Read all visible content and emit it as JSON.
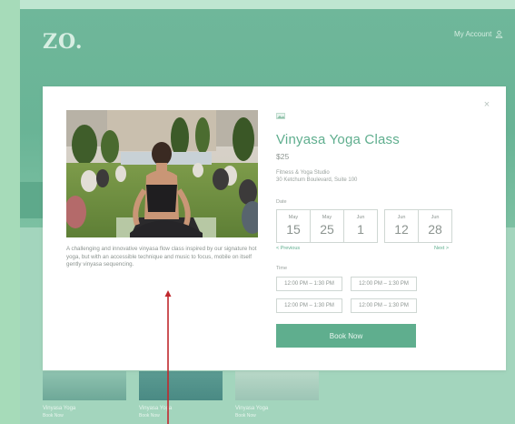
{
  "site": {
    "logo": "ZO.",
    "account_label": "My Account",
    "thumbnails": [
      {
        "title": "Vinyasa Yoga",
        "subtitle": "Book Now"
      },
      {
        "title": "Vinyasa Yoga",
        "subtitle": "Book Now"
      },
      {
        "title": "Vinyasa Yoga",
        "subtitle": "Book Now"
      }
    ]
  },
  "modal": {
    "close_glyph": "×",
    "description": "A challenging and innovative vinyasa flow class inspired by our signature hot yoga, but with an accessible technique and music to focus, mobile on itself gently vinyasa sequencing.",
    "title": "Vinyasa Yoga Class",
    "price": "$25",
    "address_line1": "Fitness & Yoga Studio",
    "address_line2": "30 Ketchum Boulevard, Suite 100",
    "date_label": "Date",
    "dates": [
      {
        "month": "May",
        "day": "15"
      },
      {
        "month": "May",
        "day": "25"
      },
      {
        "month": "Jun",
        "day": "1"
      },
      {
        "month": "Jun",
        "day": "12"
      },
      {
        "month": "Jun",
        "day": "28"
      }
    ],
    "previous_label": "< Previous",
    "next_label": "Next >",
    "time_label": "Time",
    "time_slots": [
      "12:00 PM – 1:30 PM",
      "12:00 PM – 1:30 PM",
      "12:00 PM – 1:30 PM",
      "12:00 PM – 1:30 PM"
    ],
    "book_button": "Book Now"
  },
  "colors": {
    "accent": "#5fae8e",
    "annotation_arrow": "#c0282d"
  }
}
